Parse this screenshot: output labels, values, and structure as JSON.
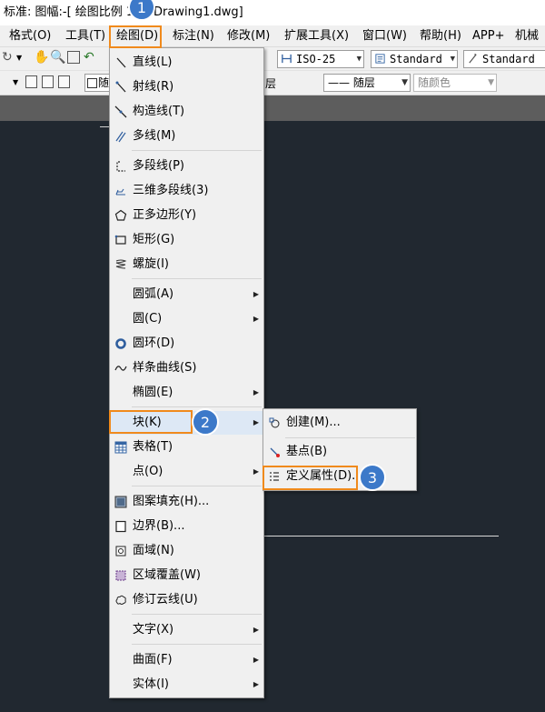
{
  "title_bar": {
    "text": "标准: 图幅:-[ 绘图比例 1:1]  Drawing1.dwg]"
  },
  "menu_bar": [
    {
      "id": "format",
      "label": "格式(O)"
    },
    {
      "id": "tools",
      "label": "工具(T)"
    },
    {
      "id": "draw",
      "label": "绘图(D)"
    },
    {
      "id": "dimension",
      "label": "标注(N)"
    },
    {
      "id": "modify",
      "label": "修改(M)"
    },
    {
      "id": "ext",
      "label": "扩展工具(X)"
    },
    {
      "id": "window",
      "label": "窗口(W)"
    },
    {
      "id": "help",
      "label": "帮助(H)"
    },
    {
      "id": "app",
      "label": "APP+"
    },
    {
      "id": "mech",
      "label": "机械"
    }
  ],
  "toolbar": {
    "dimstyle": "ISO-25",
    "textstyle": "Standard",
    "tablestyle": "Standard",
    "layer_partial": "随",
    "layer_short": "层",
    "linetype": "—— 随层",
    "color": "随颜色"
  },
  "draw_menu": [
    {
      "label": "直线(L)",
      "icon": "line-icon"
    },
    {
      "label": "射线(R)",
      "icon": "ray-icon"
    },
    {
      "label": "构造线(T)",
      "icon": "construction-line-icon"
    },
    {
      "label": "多线(M)",
      "icon": "multiline-icon"
    },
    {
      "label": "多段线(P)",
      "icon": "polyline-icon"
    },
    {
      "label": "三维多段线(3)",
      "icon": "3d-polyline-icon"
    },
    {
      "label": "正多边形(Y)",
      "icon": "polygon-icon"
    },
    {
      "label": "矩形(G)",
      "icon": "rectangle-icon"
    },
    {
      "label": "螺旋(I)",
      "icon": "helix-icon"
    },
    {
      "label": "圆弧(A)",
      "icon": ""
    },
    {
      "label": "圆(C)",
      "icon": ""
    },
    {
      "label": "圆环(D)",
      "icon": "donut-icon"
    },
    {
      "label": "样条曲线(S)",
      "icon": "spline-icon"
    },
    {
      "label": "椭圆(E)",
      "icon": ""
    },
    {
      "label": "块(K)",
      "icon": ""
    },
    {
      "label": "表格(T)",
      "icon": "table-icon"
    },
    {
      "label": "点(O)",
      "icon": ""
    },
    {
      "label": "图案填充(H)...",
      "icon": "hatch-icon"
    },
    {
      "label": "边界(B)...",
      "icon": "boundary-icon"
    },
    {
      "label": "面域(N)",
      "icon": "region-icon"
    },
    {
      "label": "区域覆盖(W)",
      "icon": "wipeout-icon"
    },
    {
      "label": "修订云线(U)",
      "icon": "revcloud-icon"
    },
    {
      "label": "文字(X)",
      "icon": ""
    },
    {
      "label": "曲面(F)",
      "icon": ""
    },
    {
      "label": "实体(I)",
      "icon": ""
    }
  ],
  "block_submenu": [
    {
      "label": "创建(M)...",
      "icon": "block-create-icon"
    },
    {
      "label": "基点(B)",
      "icon": "base-point-icon"
    },
    {
      "label": "定义属性(D)...",
      "icon": "define-attribute-icon"
    }
  ],
  "annotations": [
    {
      "number": "1"
    },
    {
      "number": "2"
    },
    {
      "number": "3"
    }
  ],
  "colors": {
    "highlight": "#f08a1c",
    "badge": "#3c79c9",
    "canvas": "#212830",
    "menu_bg": "#f0f0f0"
  }
}
